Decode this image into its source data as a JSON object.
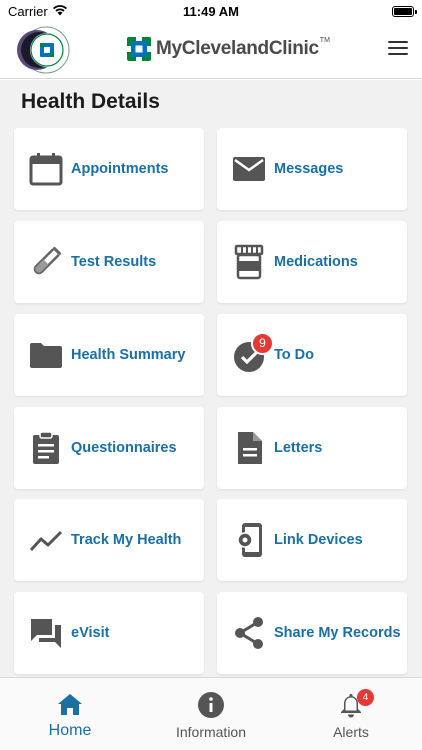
{
  "status_bar": {
    "carrier": "Carrier",
    "time": "11:49 AM"
  },
  "header": {
    "brand_name": "MyClevelandClinic",
    "brand_tm": "TM",
    "avatar_icon": "cleveland-clinic-logo-icon",
    "menu_icon": "hamburger-menu-icon"
  },
  "main": {
    "title": "Health Details",
    "tiles": [
      {
        "label": "Appointments",
        "icon": "calendar-icon"
      },
      {
        "label": "Messages",
        "icon": "envelope-icon"
      },
      {
        "label": "Test Results",
        "icon": "test-tube-icon"
      },
      {
        "label": "Medications",
        "icon": "pill-bottle-icon"
      },
      {
        "label": "Health Summary",
        "icon": "folder-icon"
      },
      {
        "label": "To Do",
        "icon": "check-circle-icon",
        "badge": "9"
      },
      {
        "label": "Questionnaires",
        "icon": "clipboard-icon"
      },
      {
        "label": "Letters",
        "icon": "document-icon"
      },
      {
        "label": "Track My Health",
        "icon": "trend-line-icon"
      },
      {
        "label": "Link Devices",
        "icon": "device-settings-icon"
      },
      {
        "label": "eVisit",
        "icon": "chat-bubbles-icon"
      },
      {
        "label": "Share My Records",
        "icon": "share-icon"
      }
    ]
  },
  "tabbar": {
    "tabs": [
      {
        "label": "Home",
        "icon": "home-icon",
        "active": true
      },
      {
        "label": "Information",
        "icon": "info-icon"
      },
      {
        "label": "Alerts",
        "icon": "bell-icon",
        "badge": "4"
      }
    ]
  },
  "colors": {
    "accent": "#1a6fa3",
    "icon_gray": "#555555",
    "badge_red": "#e53935",
    "brand_green": "#00843d",
    "background": "#f1f1f1"
  }
}
